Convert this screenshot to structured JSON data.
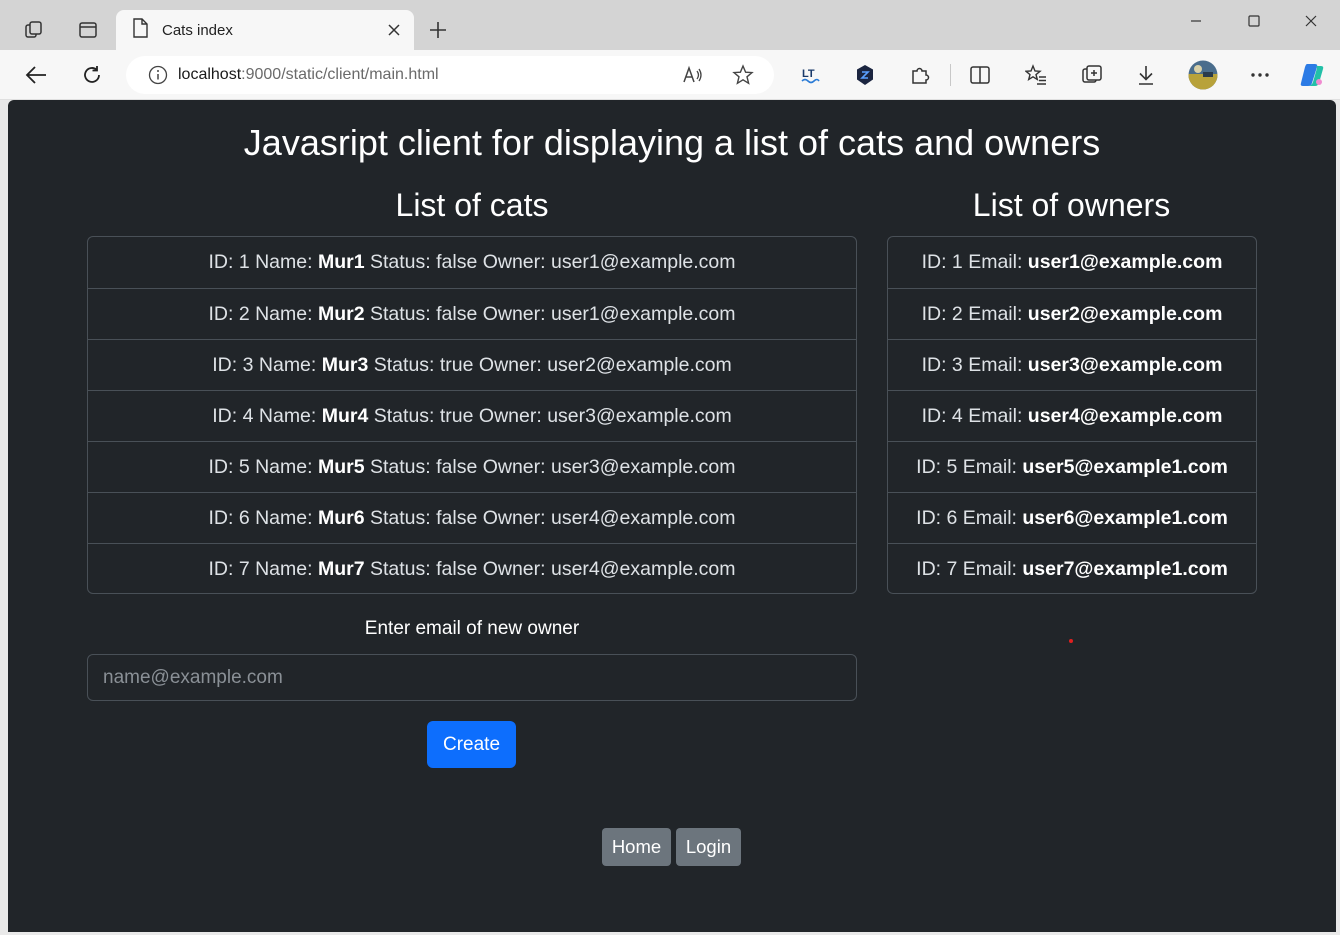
{
  "browser": {
    "tab_title": "Cats index",
    "url_host": "localhost",
    "url_rest": ":9000/static/client/main.html"
  },
  "page": {
    "title": "Javasript client for displaying a list of cats and owners",
    "cats_heading": "List of cats",
    "owners_heading": "List of owners",
    "cats": [
      {
        "id": "1",
        "name": "Mur1",
        "status": "false",
        "owner": "user1@example.com"
      },
      {
        "id": "2",
        "name": "Mur2",
        "status": "false",
        "owner": "user1@example.com"
      },
      {
        "id": "3",
        "name": "Mur3",
        "status": "true",
        "owner": "user2@example.com"
      },
      {
        "id": "4",
        "name": "Mur4",
        "status": "true",
        "owner": "user3@example.com"
      },
      {
        "id": "5",
        "name": "Mur5",
        "status": "false",
        "owner": "user3@example.com"
      },
      {
        "id": "6",
        "name": "Mur6",
        "status": "false",
        "owner": "user4@example.com"
      },
      {
        "id": "7",
        "name": "Mur7",
        "status": "false",
        "owner": "user4@example.com"
      }
    ],
    "owners": [
      {
        "id": "1",
        "email": "user1@example.com"
      },
      {
        "id": "2",
        "email": "user2@example.com"
      },
      {
        "id": "3",
        "email": "user3@example.com"
      },
      {
        "id": "4",
        "email": "user4@example.com"
      },
      {
        "id": "5",
        "email": "user5@example1.com"
      },
      {
        "id": "6",
        "email": "user6@example1.com"
      },
      {
        "id": "7",
        "email": "user7@example1.com"
      }
    ],
    "form_label": "Enter email of new owner",
    "email_placeholder": "name@example.com",
    "create_label": "Create",
    "home_label": "Home",
    "login_label": "Login"
  },
  "colors": {
    "page_bg": "#212529",
    "primary": "#0d6efd",
    "secondary": "#6c757d",
    "border": "#495057"
  }
}
